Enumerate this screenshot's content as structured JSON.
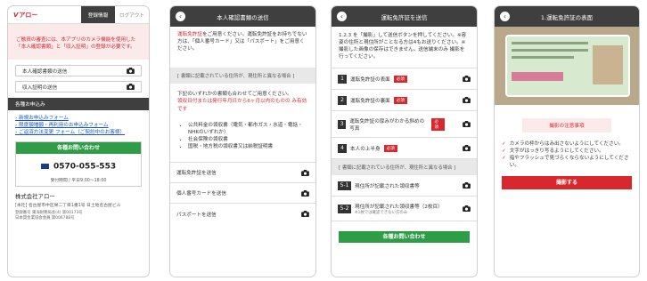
{
  "p1": {
    "logo": "アロー",
    "tab_active": "登録情報",
    "tab_logout": "ログアウト",
    "notice": "ご融資の審査には、本アプリのカメラ機能を使用した「本人確認書類」と「収入証明」の登録が必要です。",
    "upload_items": [
      "本人確認書類の送信",
      "収入証明の送信"
    ],
    "section_title": "各種お申込み",
    "links": [
      "新規お申込みフォーム",
      "限度額増額・再利用のお申込みフォーム",
      "ご返済方法変更 フォーム（ご契約中のお客様）"
    ],
    "contact_btn": "各種お問い合わせ",
    "phone": "0570-055-553",
    "hours": "受付時間 / 平日9:00〜18:00",
    "company": "株式会社アロー",
    "address": "[本社] 名古屋市中区栄二丁目1番1号 日土地名古屋ビル",
    "reg1": "登録番号 東海財務局長(4) 第00173号",
    "reg2": "日本貸金業協会会員 第006788号"
  },
  "p2": {
    "title": "本人確認書類の送信",
    "intro_red": "運転免許証",
    "intro": "をご用意ください。運転免許証をお持ちでない方は、「個人番号カード」又は「パスポート」をご用意ください。",
    "band": "[ 書類に記載されている住所が、現住所と異なる場合 ]",
    "note": "下記のいずれかの書類も合わせてご用意ください。",
    "note_red": "領収日付または発行年月日から6ヶ月以内のものの み有効です",
    "bullets": [
      "公共料金の領収書（電気・都市ガス・水道・電話・NHKのいずれか）",
      "社会保険の領収書",
      "国税・地方税の領収書又は納税証明書"
    ],
    "items": [
      "運転免許証を送信",
      "個人番号カードを送信",
      "パスポートを送信"
    ]
  },
  "p3": {
    "title": "運転免許証を送信",
    "instructions": "1.2.3 を「撮影」して送信ボタンを押してください。※容姿の住所と現住所がことなる方は4もお送りください。※撮影した画像の保存はできません。送信端末のみ 撮影を行ってください。",
    "steps": [
      {
        "num": "1",
        "label": "運転免許証の表面",
        "req": "必須"
      },
      {
        "num": "2",
        "label": "運転免許証の裏面",
        "req": "必須"
      },
      {
        "num": "3",
        "label": "運転免許証の厚みがわかる斜めの写真",
        "req": "必須"
      },
      {
        "num": "4",
        "label": "本人の上半身",
        "req": "必須"
      }
    ],
    "band": "[ 書類に記載されている住所が、現住所と異なる場合 ]",
    "subs": [
      {
        "num": "5-1",
        "label": "現住所が記載された領収書等"
      },
      {
        "num": "5-2",
        "label": "現住所が記載された領収書等（2枚目）",
        "note": "※1枚では確認できない方のみ"
      }
    ],
    "contact_btn": "各種お問い合わせ"
  },
  "p4": {
    "title": "1.運転免許証の表面",
    "caution_label": "撮影の注意事項",
    "checks": [
      "カメラの枠からはみ出さないようにしてください。",
      "文字がはっきり写るようにしてください。",
      "指やフラッシュで見づらくならないようにしてください。"
    ],
    "shoot_btn": "撮影する"
  },
  "colors": {
    "accent_red": "#d9272e",
    "green": "#2e9d45",
    "header": "#3f3f3f"
  }
}
